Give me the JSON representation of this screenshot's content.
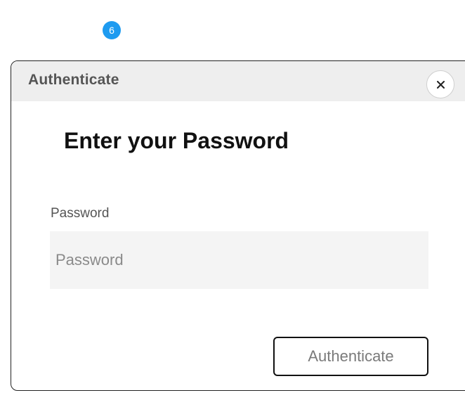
{
  "step_badge": "6",
  "dialog": {
    "title": "Authenticate",
    "close_icon": "close-icon",
    "heading": "Enter your Password",
    "password_label": "Password",
    "password_placeholder": "Password",
    "password_value": "",
    "submit_label": "Authenticate"
  },
  "colors": {
    "badge": "#1e9bf0",
    "header_bg": "#eeeeee",
    "input_bg": "#f4f4f4"
  }
}
